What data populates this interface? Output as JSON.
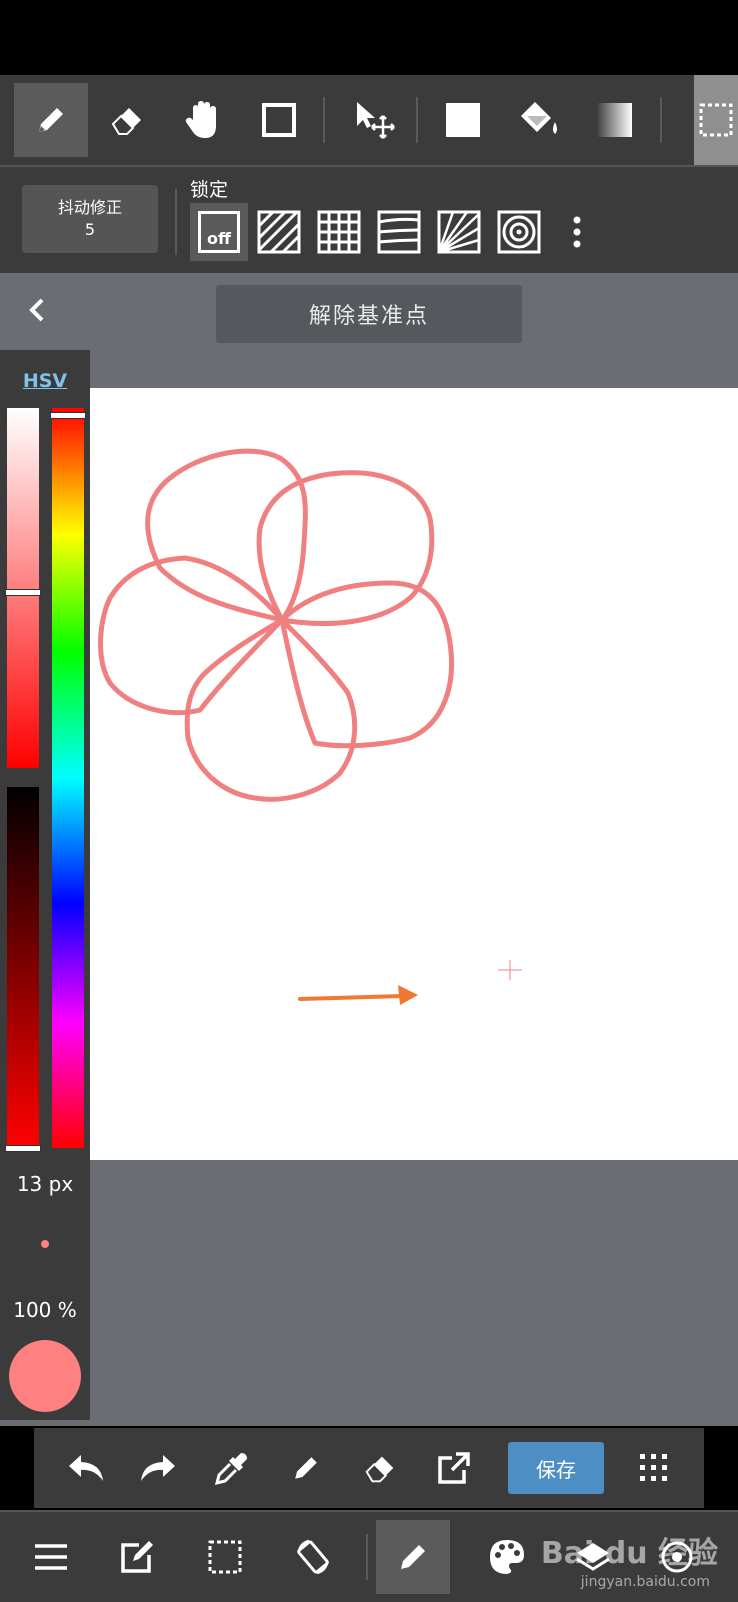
{
  "toolbar": {
    "tools": [
      "pen",
      "eraser",
      "hand",
      "rectangle",
      "move",
      "fill-color",
      "bucket",
      "gradient",
      "select"
    ]
  },
  "options": {
    "stabilizer_label": "抖动修正",
    "stabilizer_value": "5",
    "lock_label": "锁定",
    "lock_off_label": "off"
  },
  "ruler": {
    "release_label": "解除基准点"
  },
  "color_panel": {
    "mode_label": "HSV",
    "brush_size": "13 px",
    "opacity": "100 %",
    "current_color": "#ff8080"
  },
  "action_bar": {
    "save_label": "保存"
  },
  "watermark": {
    "text": "Bai du 经验",
    "sub": "jingyan.baidu.com"
  },
  "colors": {
    "accent": "#4d8fc4",
    "stroke": "#f08080",
    "arrow": "#f07830"
  }
}
